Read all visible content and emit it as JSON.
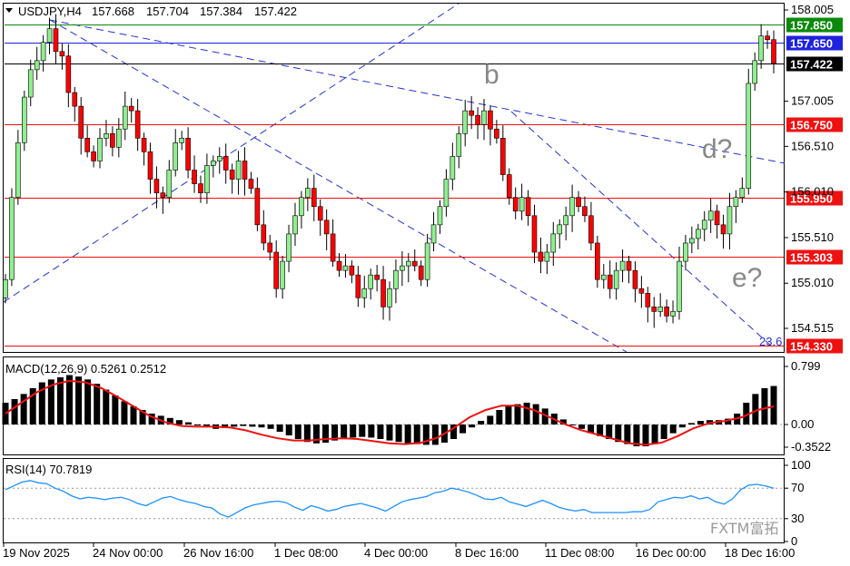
{
  "symbol_header": {
    "symbol": "USDJPY,H4",
    "open": "157.668",
    "high": "157.704",
    "low": "157.384",
    "close": "157.422"
  },
  "price_axis": {
    "ticks": [
      "158.005",
      "157.005",
      "156.510",
      "156.010",
      "155.510",
      "155.010",
      "154.515"
    ]
  },
  "price_levels": [
    {
      "value": "157.850",
      "color": "#0a8a0a"
    },
    {
      "value": "157.650",
      "color": "#1e22dd"
    },
    {
      "value": "157.422",
      "color": "#000000"
    },
    {
      "value": "156.750",
      "color": "#ee1111"
    },
    {
      "value": "155.950",
      "color": "#ee1111"
    },
    {
      "value": "155.303",
      "color": "#ee1111"
    },
    {
      "value": "154.330",
      "color": "#ee1111"
    }
  ],
  "wave_labels": [
    "b",
    "d?",
    "e?"
  ],
  "fib_label": "23.6",
  "x_axis": {
    "labels": [
      "19 Nov 2025",
      "24 Nov 00:00",
      "26 Nov 16:00",
      "1 Dec 08:00",
      "4 Dec 00:00",
      "8 Dec 16:00",
      "11 Dec 08:00",
      "16 Dec 00:00",
      "18 Dec 16:00"
    ]
  },
  "macd": {
    "title": "MACD(12,26,9) 0.5261 0.2512",
    "ticks": [
      "0.799",
      "0.00",
      "-0.3522"
    ]
  },
  "rsi": {
    "title": "RSI(14) 70.7819",
    "ticks": [
      "100",
      "70",
      "30",
      "0"
    ]
  },
  "watermark": "FXTM富拓",
  "colors": {
    "bull": "#90ee90",
    "bear": "#ff0000",
    "macd_hist": "#000000",
    "macd_signal": "#ee1111",
    "rsi_line": "#1e90ff",
    "trend_line": "#2233cc"
  },
  "chart_data": {
    "type": "candlestick",
    "instrument": "USDJPY",
    "timeframe": "H4",
    "price_ylim": [
      154.3,
      158.05
    ],
    "ohlc_close": [
      155.05,
      155.95,
      156.55,
      157.05,
      157.35,
      157.45,
      157.65,
      157.8,
      157.55,
      157.5,
      157.1,
      156.95,
      156.6,
      156.45,
      156.35,
      156.6,
      156.65,
      156.5,
      156.7,
      156.95,
      156.9,
      156.6,
      156.45,
      156.15,
      156.0,
      155.95,
      156.25,
      156.55,
      156.6,
      156.25,
      156.1,
      156.0,
      156.3,
      156.35,
      156.4,
      156.25,
      156.15,
      156.35,
      156.15,
      156.05,
      155.65,
      155.45,
      155.35,
      154.95,
      155.25,
      155.55,
      155.75,
      155.95,
      156.05,
      155.85,
      155.7,
      155.55,
      155.25,
      155.15,
      155.2,
      155.1,
      154.85,
      154.95,
      155.1,
      155.05,
      154.75,
      154.95,
      155.15,
      155.2,
      155.25,
      155.2,
      155.05,
      155.45,
      155.65,
      155.85,
      156.15,
      156.4,
      156.65,
      156.9,
      156.85,
      156.75,
      156.9,
      156.7,
      156.6,
      156.2,
      155.95,
      155.8,
      155.95,
      155.75,
      155.35,
      155.25,
      155.35,
      155.55,
      155.65,
      155.75,
      155.95,
      155.85,
      155.75,
      155.45,
      155.05,
      155.1,
      154.95,
      155.15,
      155.25,
      155.15,
      154.95,
      154.9,
      154.75,
      154.7,
      154.75,
      154.65,
      154.7,
      155.25,
      155.45,
      155.5,
      155.6,
      155.7,
      155.8,
      155.65,
      155.55,
      155.85,
      155.95,
      156.05,
      157.2,
      157.45,
      157.72,
      157.68,
      157.42
    ],
    "macd": {
      "histogram": [
        0.3,
        0.35,
        0.42,
        0.5,
        0.58,
        0.62,
        0.65,
        0.68,
        0.66,
        0.62,
        0.56,
        0.48,
        0.4,
        0.32,
        0.25,
        0.2,
        0.15,
        0.12,
        0.09,
        0.06,
        0.03,
        0.0,
        -0.03,
        -0.06,
        -0.05,
        -0.03,
        -0.02,
        -0.03,
        -0.04,
        -0.06,
        -0.1,
        -0.15,
        -0.2,
        -0.24,
        -0.26,
        -0.25,
        -0.22,
        -0.2,
        -0.18,
        -0.17,
        -0.18,
        -0.2,
        -0.22,
        -0.24,
        -0.26,
        -0.27,
        -0.28,
        -0.28,
        -0.25,
        -0.2,
        -0.12,
        -0.04,
        0.05,
        0.12,
        0.2,
        0.25,
        0.28,
        0.3,
        0.28,
        0.22,
        0.15,
        0.07,
        0.0,
        -0.06,
        -0.12,
        -0.16,
        -0.2,
        -0.24,
        -0.27,
        -0.3,
        -0.3,
        -0.27,
        -0.2,
        -0.12,
        -0.04,
        0.02,
        0.05,
        0.06,
        0.06,
        0.08,
        0.15,
        0.3,
        0.42,
        0.5,
        0.53
      ],
      "signal": [
        0.15,
        0.3,
        0.45,
        0.55,
        0.6,
        0.58,
        0.5,
        0.38,
        0.25,
        0.12,
        0.03,
        -0.02,
        -0.03,
        -0.03,
        -0.04,
        -0.08,
        -0.14,
        -0.19,
        -0.22,
        -0.22,
        -0.2,
        -0.19,
        -0.2,
        -0.23,
        -0.26,
        -0.27,
        -0.25,
        -0.18,
        -0.05,
        0.1,
        0.2,
        0.26,
        0.26,
        0.2,
        0.1,
        0.0,
        -0.08,
        -0.14,
        -0.2,
        -0.26,
        -0.28,
        -0.25,
        -0.16,
        -0.05,
        0.02,
        0.05,
        0.1,
        0.2,
        0.25
      ]
    },
    "rsi": {
      "values": [
        68,
        73,
        78,
        80,
        77,
        76,
        70,
        66,
        60,
        56,
        58,
        57,
        55,
        57,
        58,
        55,
        50,
        47,
        52,
        57,
        59,
        55,
        52,
        50,
        46,
        44,
        36,
        32,
        38,
        44,
        48,
        50,
        52,
        53,
        51,
        45,
        41,
        47,
        44,
        40,
        42,
        46,
        48,
        50,
        47,
        44,
        40,
        46,
        52,
        55,
        57,
        59,
        64,
        66,
        70,
        68,
        65,
        61,
        56,
        55,
        58,
        52,
        49,
        46,
        50,
        54,
        50,
        45,
        42,
        40,
        42,
        38,
        38,
        38,
        38,
        38,
        39,
        39,
        42,
        52,
        55,
        58,
        57,
        60,
        56,
        58,
        52,
        49,
        56,
        68,
        74,
        75,
        73,
        70
      ],
      "levels": [
        70,
        30
      ]
    }
  }
}
